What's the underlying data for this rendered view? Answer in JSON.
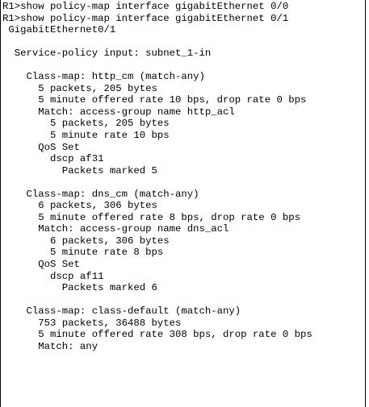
{
  "terminal": {
    "lines": [
      "R1>show policy-map interface gigabitEthernet 0/0",
      "R1>show policy-map interface gigabitEthernet 0/1",
      " GigabitEthernet0/1",
      "",
      "  Service-policy input: subnet_1-in",
      "",
      "    Class-map: http_cm (match-any)",
      "      5 packets, 205 bytes",
      "      5 minute offered rate 10 bps, drop rate 0 bps",
      "      Match: access-group name http_acl",
      "        5 packets, 205 bytes",
      "        5 minute rate 10 bps",
      "      QoS Set",
      "        dscp af31",
      "          Packets marked 5",
      "",
      "    Class-map: dns_cm (match-any)",
      "      6 packets, 306 bytes",
      "      5 minute offered rate 8 bps, drop rate 0 bps",
      "      Match: access-group name dns_acl",
      "        6 packets, 306 bytes",
      "        5 minute rate 8 bps",
      "      QoS Set",
      "        dscp af11",
      "          Packets marked 6",
      "",
      "    Class-map: class-default (match-any)",
      "      753 packets, 36488 bytes",
      "      5 minute offered rate 308 bps, drop rate 0 bps",
      "      Match: any"
    ]
  }
}
